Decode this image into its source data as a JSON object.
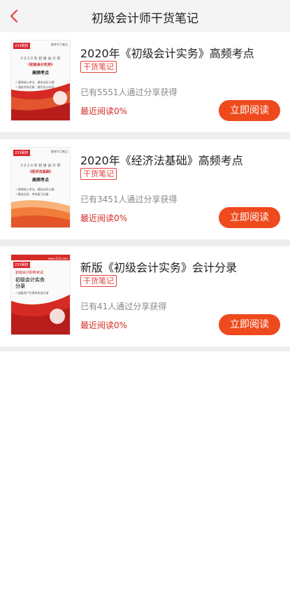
{
  "header": {
    "title": "初级会计师干货笔记",
    "back_icon": "chevron-left-icon",
    "accent": "#e2413a"
  },
  "items": [
    {
      "title": "2020年《初级会计实务》高频考点",
      "badge": "干货笔记",
      "share_text": "已有5551人通过分享获得",
      "recent_read": "最近阅读0%",
      "button": "立即阅读",
      "cover": {
        "logo": "233网校",
        "tag": "备考学习笔记",
        "line1": "2 0 2 0 年 初 级 会 计 师",
        "book": "《初级会计实务》",
        "heading": "高频考点",
        "note1": "• 图线核心考点、精选全彩大纲",
        "note2": "• 通俗学知识脉、精华设计布局"
      }
    },
    {
      "title": "2020年《经济法基础》高频考点",
      "badge": "干货笔记",
      "share_text": "已有3451人通过分享获得",
      "recent_read": "最近阅读0%",
      "button": "立即阅读",
      "cover": {
        "logo": "233网校",
        "tag": "备考学习笔记",
        "line1": "2 0 2 0 年 初 级 会 计 师",
        "book": "《经济法基础》",
        "heading": "高频考点",
        "note1": "• 图线核心考点、精选全彩大纲",
        "note2": "• 精选法条、考前复习必备"
      }
    },
    {
      "title": "新版《初级会计实务》会计分录",
      "badge": "干货笔记",
      "share_text": "已有41人通过分享获得",
      "recent_read": "最近阅读0%",
      "button": "立即阅读",
      "cover": {
        "logo": "233网校",
        "tag": "www.233.com",
        "line1": "初级会计职称考试",
        "heading1": "初级会计实务",
        "heading2": "分录",
        "note1": "• 涵盖资产负债所有类分录"
      }
    }
  ]
}
